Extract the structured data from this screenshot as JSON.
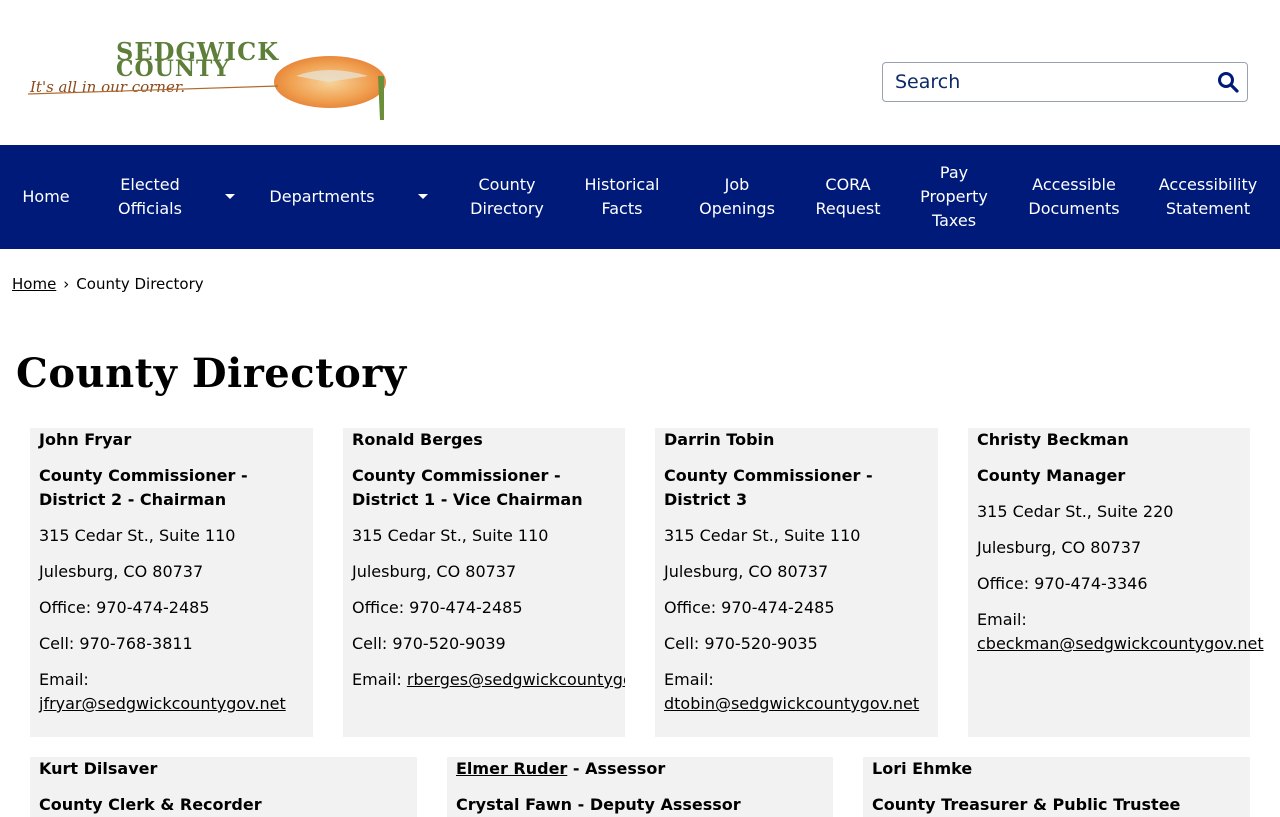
{
  "header": {
    "logo_title": "SEDGWICK COUNTY",
    "logo_tagline": "It's all in our corner.",
    "search_placeholder": "Search"
  },
  "nav": {
    "items": [
      {
        "label": "Home"
      },
      {
        "label": "Elected Officials"
      },
      {
        "label": "Departments"
      },
      {
        "label": "County Directory"
      },
      {
        "label": "Historical Facts"
      },
      {
        "label": "Job Openings"
      },
      {
        "label": "CORA Request"
      },
      {
        "label": "Pay Property Taxes"
      },
      {
        "label": "Accessible Documents"
      },
      {
        "label": "Accessibility Statement"
      }
    ]
  },
  "breadcrumb": {
    "home": "Home",
    "separator": "›",
    "current": "County Directory"
  },
  "page_title": "County Directory",
  "cards": [
    {
      "name": "John Fryar",
      "title_1": "County Commissioner -",
      "title_2": "District 2 - Chairman",
      "address": "315 Cedar St., Suite 110",
      "city": "Julesburg, CO 80737",
      "office": "Office: 970-474-2485",
      "cell": "Cell: 970-768-3811",
      "email_label": "Email:",
      "email": "jfryar@sedgwickcountygov.net"
    },
    {
      "name": "Ronald Berges",
      "title_1": "County Commissioner -",
      "title_2": "District 1 - Vice Chairman",
      "address": "315 Cedar St., Suite 110",
      "city": "Julesburg, CO 80737",
      "office": "Office: 970-474-2485",
      "cell": "Cell: 970-520-9039",
      "email_label": "Email:",
      "email": "rberges@sedgwickcountygov.n"
    },
    {
      "name": "Darrin Tobin",
      "title_1": "County Commissioner -",
      "title_2": "District 3",
      "address": "315 Cedar St., Suite 110",
      "city": "Julesburg, CO 80737",
      "office": "Office: 970-474-2485",
      "cell": "Cell: 970-520-9035",
      "email_label": "Email:",
      "email": "dtobin@sedgwickcountygov.net"
    },
    {
      "name": "Christy Beckman",
      "title_1": "County Manager",
      "address": "315 Cedar St., Suite 220",
      "city": "Julesburg, CO 80737",
      "office": "Office: 970-474-3346",
      "email_label": "Email:",
      "email": "cbeckman@sedgwickcountygov.net"
    },
    {
      "name": "Kurt Dilsaver",
      "title_1": "County Clerk & Recorder"
    },
    {
      "name_link": "Elmer Ruder",
      "name_suffix": " - Assessor",
      "title_1": "Crystal Fawn - Deputy Assessor"
    },
    {
      "name": "Lori Ehmke",
      "title_1": "County Treasurer & Public Trustee"
    }
  ]
}
